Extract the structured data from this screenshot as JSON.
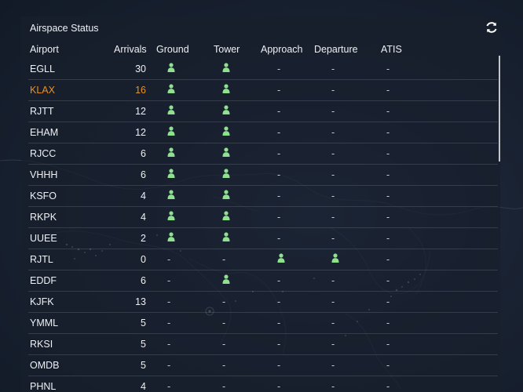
{
  "panel": {
    "title": "Airspace Status"
  },
  "columns": {
    "airport": "Airport",
    "arrivals": "Arrivals",
    "ground": "Ground",
    "tower": "Tower",
    "approach": "Approach",
    "departure": "Departure",
    "atis": "ATIS"
  },
  "icons": {
    "refresh": "refresh-icon",
    "controller": "person-icon"
  },
  "colors": {
    "online": "#8fe08f",
    "highlight": "#e8902a",
    "text": "#eef0f3"
  },
  "empty_marker": "-",
  "rows": [
    {
      "airport": "EGLL",
      "arrivals": "30",
      "ground": true,
      "tower": true,
      "approach": false,
      "departure": false,
      "atis": false
    },
    {
      "airport": "KLAX",
      "arrivals": "16",
      "ground": true,
      "tower": true,
      "approach": false,
      "departure": false,
      "atis": false,
      "highlight": true
    },
    {
      "airport": "RJTT",
      "arrivals": "12",
      "ground": true,
      "tower": true,
      "approach": false,
      "departure": false,
      "atis": false
    },
    {
      "airport": "EHAM",
      "arrivals": "12",
      "ground": true,
      "tower": true,
      "approach": false,
      "departure": false,
      "atis": false
    },
    {
      "airport": "RJCC",
      "arrivals": "6",
      "ground": true,
      "tower": true,
      "approach": false,
      "departure": false,
      "atis": false
    },
    {
      "airport": "VHHH",
      "arrivals": "6",
      "ground": true,
      "tower": true,
      "approach": false,
      "departure": false,
      "atis": false
    },
    {
      "airport": "KSFO",
      "arrivals": "4",
      "ground": true,
      "tower": true,
      "approach": false,
      "departure": false,
      "atis": false
    },
    {
      "airport": "RKPK",
      "arrivals": "4",
      "ground": true,
      "tower": true,
      "approach": false,
      "departure": false,
      "atis": false
    },
    {
      "airport": "UUEE",
      "arrivals": "2",
      "ground": true,
      "tower": true,
      "approach": false,
      "departure": false,
      "atis": false
    },
    {
      "airport": "RJTL",
      "arrivals": "0",
      "ground": false,
      "tower": false,
      "approach": true,
      "departure": true,
      "atis": false
    },
    {
      "airport": "EDDF",
      "arrivals": "6",
      "ground": false,
      "tower": true,
      "approach": false,
      "departure": false,
      "atis": false
    },
    {
      "airport": "KJFK",
      "arrivals": "13",
      "ground": false,
      "tower": false,
      "approach": false,
      "departure": false,
      "atis": false
    },
    {
      "airport": "YMML",
      "arrivals": "5",
      "ground": false,
      "tower": false,
      "approach": false,
      "departure": false,
      "atis": false
    },
    {
      "airport": "RKSI",
      "arrivals": "5",
      "ground": false,
      "tower": false,
      "approach": false,
      "departure": false,
      "atis": false
    },
    {
      "airport": "OMDB",
      "arrivals": "5",
      "ground": false,
      "tower": false,
      "approach": false,
      "departure": false,
      "atis": false
    },
    {
      "airport": "PHNL",
      "arrivals": "4",
      "ground": false,
      "tower": false,
      "approach": false,
      "departure": false,
      "atis": false
    }
  ]
}
